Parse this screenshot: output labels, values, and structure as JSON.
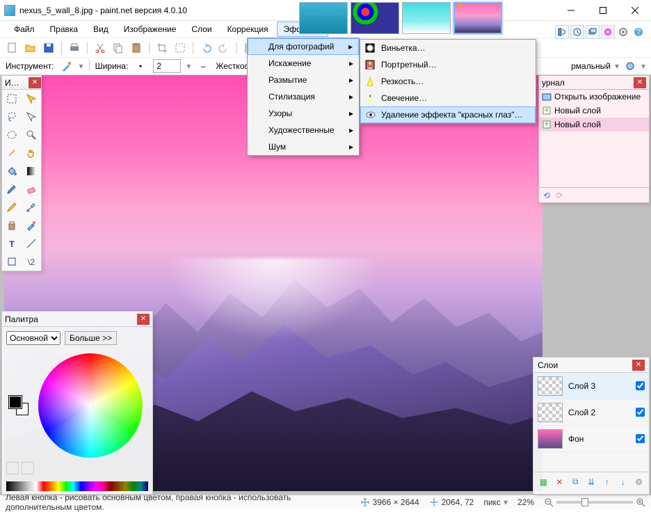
{
  "window": {
    "title": "nexus_5_wall_8.jpg - paint.net версия 4.0.10"
  },
  "menubar": {
    "file": "Файл",
    "edit": "Правка",
    "view": "Вид",
    "image": "Изображение",
    "layers": "Слои",
    "adjustments": "Коррекция",
    "effects": "Эффекты"
  },
  "optbar": {
    "tool_label": "Инструмент:",
    "width_label": "Ширина:",
    "width_value": "2",
    "hardness_label": "Жесткость:",
    "blend_label": "рмальный",
    "blend_full": "Нормальный"
  },
  "effects_menu": {
    "photo": "Для фотографий",
    "distort": "Искажение",
    "blur": "Размытие",
    "stylize": "Стилизация",
    "patterns": "Узоры",
    "artistic": "Художественные",
    "noise": "Шум"
  },
  "photo_submenu": {
    "vignette": "Виньетка…",
    "portrait": "Портретный…",
    "sharpen": "Резкость…",
    "glow": "Свечение…",
    "redeye": "Удаление эффекта \"красных глаз\"…"
  },
  "tools_panel": {
    "title": "И…"
  },
  "palette_panel": {
    "title": "Палитра",
    "primary": "Основной",
    "more": "Больше >>"
  },
  "history_panel": {
    "title": "урнал",
    "title_full": "Журнал",
    "items": [
      "Открыть изображение",
      "Новый слой",
      "Новый слой"
    ]
  },
  "layers_panel": {
    "title": "Слои",
    "items": [
      {
        "name": "Слой 3",
        "visible": true
      },
      {
        "name": "Слой 2",
        "visible": true
      },
      {
        "name": "Фон",
        "visible": true
      }
    ]
  },
  "status": {
    "hint": "Левая кнопка - рисовать основным цветом, правая кнопка - использовать дополнительным цветом.",
    "dimensions": "3966 × 2644",
    "cursor": "2064, 72",
    "units": "пикс",
    "zoom": "22%"
  }
}
